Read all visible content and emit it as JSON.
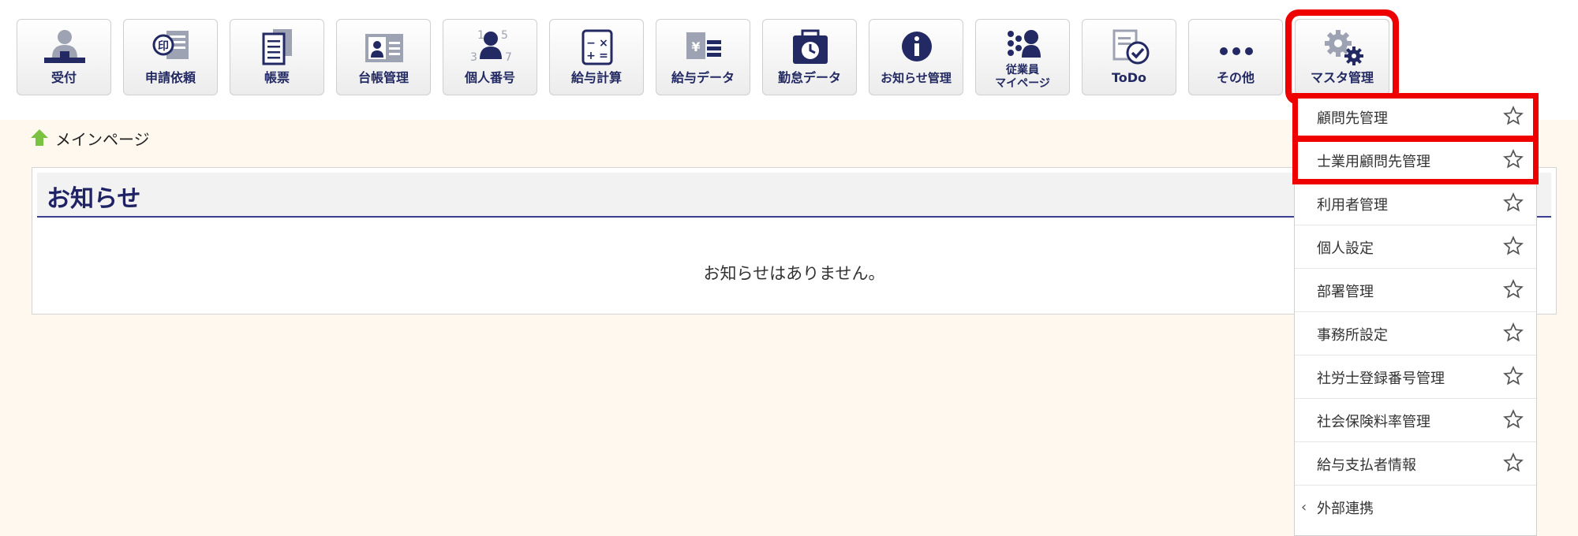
{
  "toolbar": {
    "buttons": [
      {
        "label": "受付",
        "icon": "receptionist-icon"
      },
      {
        "label": "申請依頼",
        "icon": "stamp-document-icon"
      },
      {
        "label": "帳票",
        "icon": "forms-stack-icon"
      },
      {
        "label": "台帳管理",
        "icon": "id-card-icon"
      },
      {
        "label": "個人番号",
        "icon": "person-number-icon"
      },
      {
        "label": "給与計算",
        "icon": "calculator-icon"
      },
      {
        "label": "給与データ",
        "icon": "salary-data-icon"
      },
      {
        "label": "勤怠データ",
        "icon": "timecard-clock-icon"
      },
      {
        "label": "お知らせ管理",
        "icon": "info-icon"
      },
      {
        "label_line1": "従業員",
        "label_line2": "マイページ",
        "icon": "employee-mypage-icon"
      },
      {
        "label": "ToDo",
        "icon": "todo-check-icon"
      },
      {
        "label": "その他",
        "icon": "more-dots-icon"
      },
      {
        "label": "マスタ管理",
        "icon": "gears-icon"
      }
    ]
  },
  "breadcrumb": {
    "label": "メインページ",
    "icon": "home-arrow-icon"
  },
  "notice": {
    "title": "お知らせ",
    "empty_message": "お知らせはありません。"
  },
  "master_menu": {
    "items": [
      {
        "label": "顧問先管理"
      },
      {
        "label": "士業用顧問先管理"
      },
      {
        "label": "利用者管理"
      },
      {
        "label": "個人設定"
      },
      {
        "label": "部署管理"
      },
      {
        "label": "事務所設定"
      },
      {
        "label": "社労士登録番号管理"
      },
      {
        "label": "社会保険料率管理"
      },
      {
        "label": "給与支払者情報"
      },
      {
        "label": "外部連携"
      }
    ]
  },
  "colors": {
    "icon_navy": "#232a63",
    "icon_gray": "#9ea3b3",
    "highlight_red": "#e00000",
    "content_bg": "#fff8ee",
    "home_green": "#7cc242"
  }
}
